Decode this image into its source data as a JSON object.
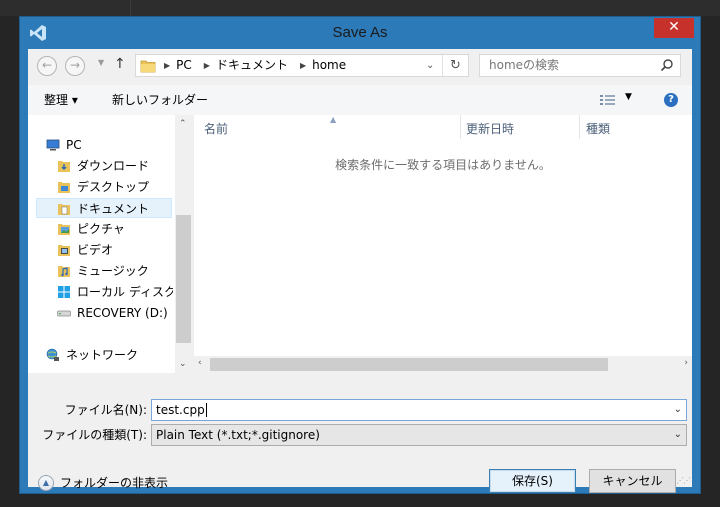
{
  "window": {
    "title": "Save As",
    "close_label": "✕"
  },
  "address": {
    "crumbs": [
      "PC",
      "ドキュメント",
      "home"
    ],
    "search_placeholder": "homeの検索"
  },
  "toolbar": {
    "organize_label": "整理 ▾",
    "new_folder_label": "新しいフォルダー",
    "help_label": "?"
  },
  "nav": {
    "items": [
      {
        "label": "PC",
        "icon": "pc-icon"
      },
      {
        "label": "ダウンロード",
        "icon": "folder-download-icon"
      },
      {
        "label": "デスクトップ",
        "icon": "folder-desktop-icon"
      },
      {
        "label": "ドキュメント",
        "icon": "folder-documents-icon",
        "selected": true
      },
      {
        "label": "ピクチャ",
        "icon": "folder-pictures-icon"
      },
      {
        "label": "ビデオ",
        "icon": "folder-videos-icon"
      },
      {
        "label": "ミュージック",
        "icon": "folder-music-icon"
      },
      {
        "label": "ローカル ディスク (C",
        "icon": "windows-drive-icon"
      },
      {
        "label": "RECOVERY (D:)",
        "icon": "drive-icon"
      },
      {
        "label": "ネットワーク",
        "icon": "network-icon"
      }
    ]
  },
  "filelist": {
    "columns": [
      "名前",
      "更新日時",
      "種類"
    ],
    "empty_message": "検索条件に一致する項目はありません。"
  },
  "form": {
    "filename_label": "ファイル名(N):",
    "filename_value": "test.cpp",
    "filetype_label": "ファイルの種類(T):",
    "filetype_value": "Plain Text (*.txt;*.gitignore)"
  },
  "footer": {
    "hide_folders_label": "フォルダーの非表示",
    "save_label": "保存(S)",
    "cancel_label": "キャンセル"
  },
  "colors": {
    "accent": "#2d7ab8",
    "close": "#c7312b",
    "selection": "#e5f1fb"
  }
}
